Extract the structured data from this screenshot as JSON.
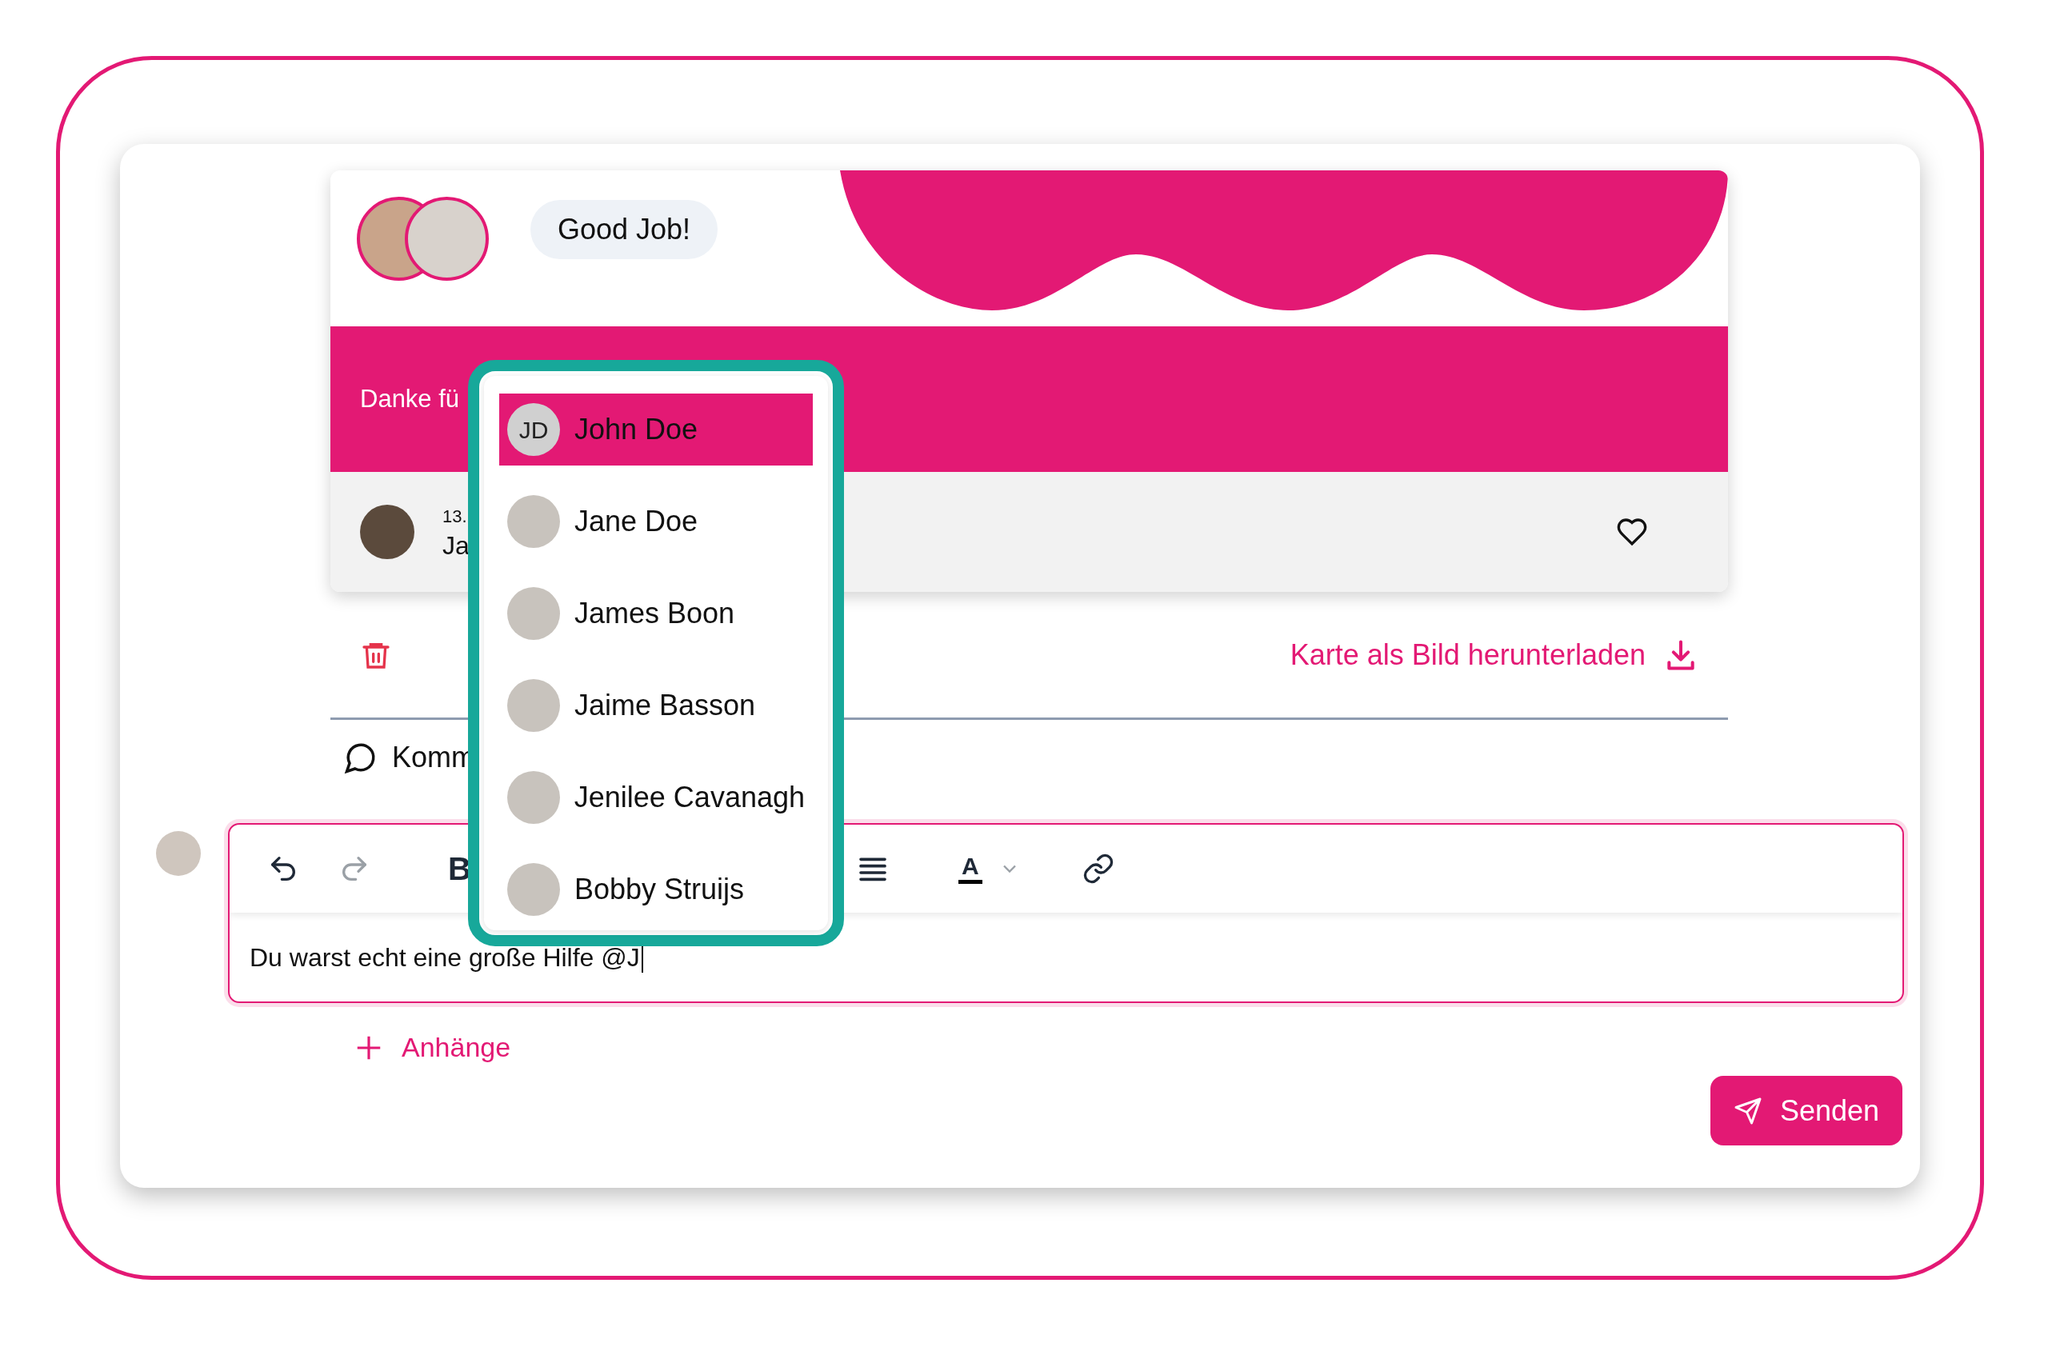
{
  "card": {
    "title": "Good Job!",
    "message": "Danke fü",
    "footer": {
      "date": "13.",
      "name": "Ja"
    }
  },
  "actions": {
    "download_link": "Karte als Bild herunterladen"
  },
  "comments": {
    "label": "Komm"
  },
  "editor": {
    "toolbar": [
      {
        "kind": "undo",
        "disabled": false
      },
      {
        "kind": "redo",
        "disabled": true
      },
      {
        "kind": "bold",
        "label": "B"
      },
      {
        "kind": "align"
      },
      {
        "kind": "color",
        "label": "A"
      },
      {
        "kind": "link"
      }
    ],
    "value": "Du warst echt eine große Hilfe @J"
  },
  "attachments": "Anhänge",
  "send_button": "Senden",
  "mention_menu": {
    "items": [
      {
        "name": "John Doe",
        "initials": "JD",
        "selected": true
      },
      {
        "name": "Jane Doe",
        "selected": false
      },
      {
        "name": "James Boon",
        "selected": false
      },
      {
        "name": "Jaime Basson",
        "selected": false
      },
      {
        "name": "Jenilee Cavanagh",
        "selected": false
      },
      {
        "name": "Bobby Struijs",
        "selected": false
      }
    ]
  }
}
